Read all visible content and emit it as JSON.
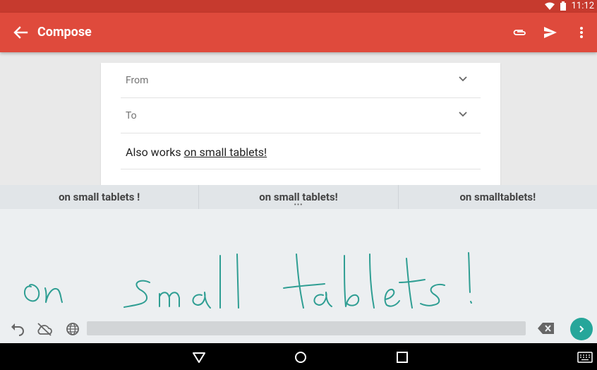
{
  "status_bar": {
    "time": "11:12",
    "icons": [
      "wifi-icon",
      "battery-icon"
    ]
  },
  "app_bar": {
    "title": "Compose",
    "icons": [
      "back-arrow-icon",
      "paperclip-icon",
      "send-icon",
      "overflow-menu-icon"
    ],
    "color": "#df4a3c"
  },
  "compose": {
    "from_label": "From",
    "to_label": "To",
    "subject_prefix": "Also works ",
    "subject_underlined": "on small tablets!"
  },
  "suggestions": [
    "on small tablets !",
    "on small tablets!",
    "on smalltablets!"
  ],
  "handwriting": {
    "text": "on small tablets!",
    "ink_color": "#2f9e93"
  },
  "keyboard_toolbar": {
    "icons": [
      "undo-icon",
      "cloud-off-icon",
      "globe-icon",
      "backspace-icon",
      "next-arrow-icon"
    ],
    "accent": "#26a69a"
  },
  "nav_bar": {
    "icons": [
      "back-triangle-icon",
      "home-circle-icon",
      "recents-square-icon",
      "keyboard-icon"
    ]
  }
}
